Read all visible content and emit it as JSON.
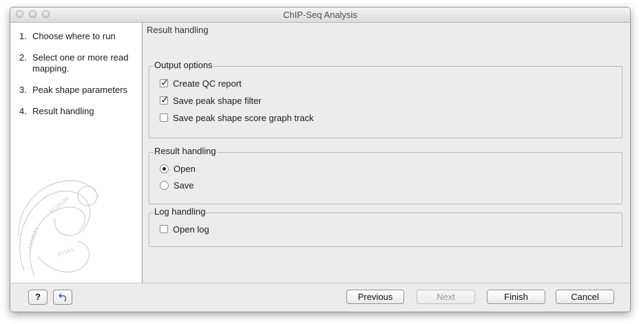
{
  "window": {
    "title": "ChIP-Seq Analysis"
  },
  "steps": [
    {
      "num": "1.",
      "label": "Choose where to run"
    },
    {
      "num": "2.",
      "label": "Select one or more read mapping."
    },
    {
      "num": "3.",
      "label": "Peak shape parameters"
    },
    {
      "num": "4.",
      "label": "Result handling"
    }
  ],
  "main": {
    "heading": "Result handling",
    "output_options": {
      "legend": "Output options",
      "items": [
        {
          "label": "Create QC report",
          "checked": true
        },
        {
          "label": "Save peak shape filter",
          "checked": true
        },
        {
          "label": "Save peak shape score graph track",
          "checked": false
        }
      ]
    },
    "result_handling": {
      "legend": "Result handling",
      "options": [
        {
          "label": "Open",
          "selected": true
        },
        {
          "label": "Save",
          "selected": false
        }
      ]
    },
    "log_handling": {
      "legend": "Log handling",
      "items": [
        {
          "label": "Open log",
          "checked": false
        }
      ]
    }
  },
  "footer": {
    "help": "?",
    "reset_icon": "undo-arrow-icon",
    "previous": "Previous",
    "next": "Next",
    "finish": "Finish",
    "cancel": "Cancel"
  }
}
